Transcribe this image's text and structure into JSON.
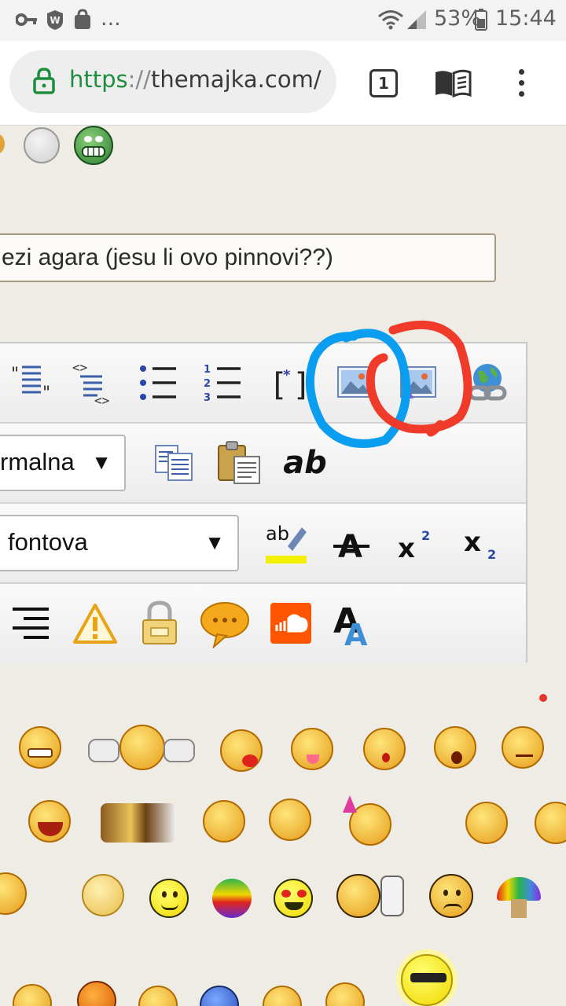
{
  "status_bar": {
    "more": "...",
    "battery_pct": "53%",
    "time": "15:44"
  },
  "browser": {
    "url_scheme": "https",
    "url_sep": "://",
    "url_host": "themajka.com/",
    "tab_count": "1"
  },
  "form": {
    "title_value": "ezi agara (jesu li ovo pinnovi??)"
  },
  "editor": {
    "size_select_value": "rmalna",
    "font_select_value": "fontova",
    "highlight_label": "ab",
    "paste_text_label": "ab",
    "select_arrow": "▼"
  },
  "colors": {
    "annotation_blue": "#0a9df0",
    "annotation_red": "#f03a2a",
    "url_scheme": "#1e8e3e",
    "page_bg": "#efece5"
  },
  "icons": {
    "toolbar_row1": [
      "blockquote-icon",
      "code-icon",
      "bullet-list-icon",
      "numbered-list-icon",
      "spoiler-icon",
      "image-icon",
      "image-upload-icon",
      "link-icon"
    ],
    "toolbar_row2": [
      "copy-icon",
      "paste-icon",
      "paste-text-icon"
    ],
    "toolbar_row3": [
      "highlight-icon",
      "strikethrough-icon",
      "superscript-icon",
      "subscript-icon"
    ],
    "toolbar_row4": [
      "align-right-icon",
      "warning-icon",
      "lock-icon",
      "speech-bubble-icon",
      "soundcloud-icon",
      "font-color-icon"
    ]
  }
}
